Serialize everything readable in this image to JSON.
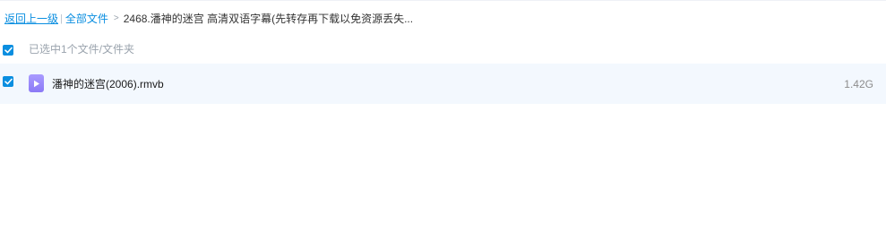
{
  "breadcrumb": {
    "back_label": "返回上一级",
    "separator": "|",
    "all_files_label": "全部文件",
    "arrow": ">",
    "current_folder": "2468.潘神的迷宫 高清双语字幕(先转存再下载以免资源丢失..."
  },
  "selection": {
    "checked": true,
    "status_text": "已选中1个文件/文件夹"
  },
  "files": [
    {
      "checked": true,
      "icon": "video-file-icon",
      "name": "潘神的迷宫(2006).rmvb",
      "size": "1.42G"
    }
  ],
  "colors": {
    "accent": "#0a8ee0",
    "row_highlight": "#f3f8fe",
    "video_icon": "#9a8af8"
  }
}
